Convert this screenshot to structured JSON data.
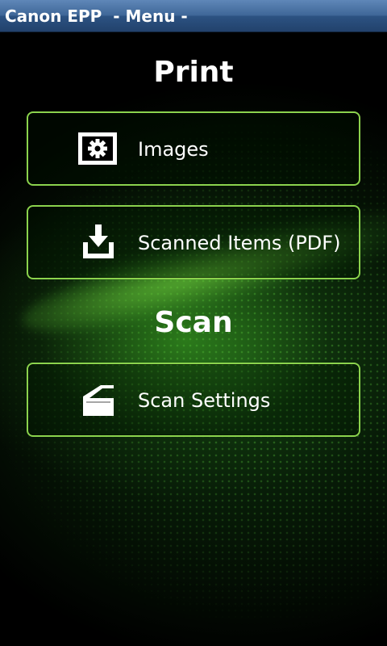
{
  "window": {
    "title": "Canon EPP  - Menu -"
  },
  "sections": {
    "print": {
      "title": "Print",
      "items": [
        {
          "label": "Images",
          "icon": "image-gear-icon"
        },
        {
          "label": "Scanned Items (PDF)",
          "icon": "download-tray-icon"
        }
      ]
    },
    "scan": {
      "title": "Scan",
      "items": [
        {
          "label": "Scan Settings",
          "icon": "scanner-icon"
        }
      ]
    }
  },
  "colors": {
    "title_bar": "#3f6798",
    "button_border": "#8bd34d",
    "background": "#000000",
    "glow": "#46be28"
  }
}
